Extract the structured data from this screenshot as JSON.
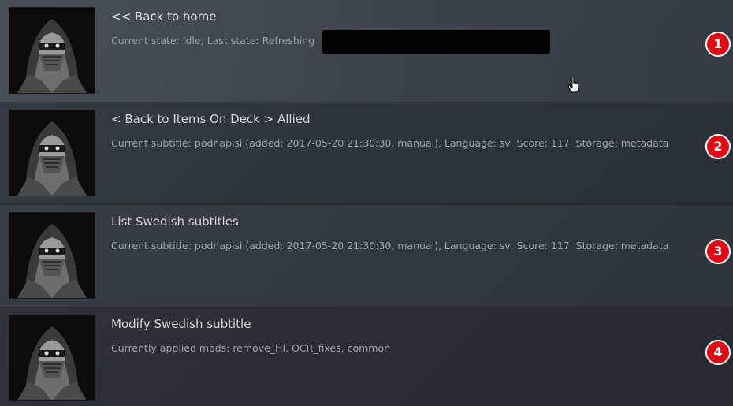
{
  "rows": [
    {
      "title": "<< Back to home",
      "subtitle": "Current state: Idle; Last state: Refreshing",
      "badge": "1"
    },
    {
      "title": "< Back to Items On Deck > Allied",
      "subtitle": "Current subtitle: podnapisi (added: 2017-05-20 21:30:30, manual), Language: sv, Score: 117, Storage: metadata",
      "badge": "2"
    },
    {
      "title": "List Swedish subtitles",
      "subtitle": "Current subtitle: podnapisi (added: 2017-05-20 21:30:30, manual), Language: sv, Score: 117, Storage: metadata",
      "badge": "3"
    },
    {
      "title": "Modify Swedish subtitle",
      "subtitle": "Currently applied mods: remove_HI, OCR_fixes, common",
      "badge": "4"
    }
  ],
  "colors": {
    "badge": "#e30613",
    "title": "#e6e6e6",
    "subtitle": "#9ea3aa"
  },
  "icons": {
    "thumbnail": "masked-ninja-poster",
    "cursor": "hand-pointer-cursor"
  }
}
